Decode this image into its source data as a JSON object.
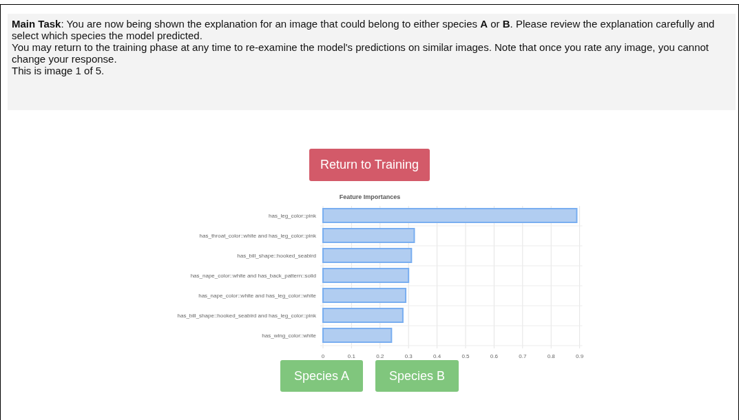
{
  "instructions": [
    "**Main Task**: You are now being shown the explanation for an image that could belong to either species **A** or **B**. Please review the explanation carefully and select which species the model predicted.",
    "You may return to the training phase at any time to re-examine the model's predictions on similar images. Note that once you rate any image, you cannot change your response.",
    "This is image 1 of 5."
  ],
  "return_button": "Return to Training",
  "chart": {
    "chart_data": {
      "type": "bar",
      "orientation": "horizontal",
      "title": "Feature Importances",
      "categories": [
        "has_leg_color::pink",
        "has_throat_color::white and has_leg_color::pink",
        "has_bill_shape::hooked_seabird",
        "has_nape_color::white and has_back_pattern::solid",
        "has_nape_color::white and has_leg_color::white",
        "has_bill_shape::hooked_seabird and has_leg_color::pink",
        "has_wing_color::white"
      ],
      "grid": true,
      "series": [
        {
          "color": "#b1cdf1",
          "values": [
            0.89,
            0.32,
            0.31,
            0.3,
            0.29,
            0.28,
            0.24
          ]
        }
      ],
      "xlim": [
        0,
        0.9
      ],
      "xticks": [
        0,
        0.1,
        0.2,
        0.3,
        0.4,
        0.5,
        0.6,
        0.7,
        0.8,
        0.9
      ]
    }
  },
  "choices": [
    "Species A",
    "Species B"
  ]
}
